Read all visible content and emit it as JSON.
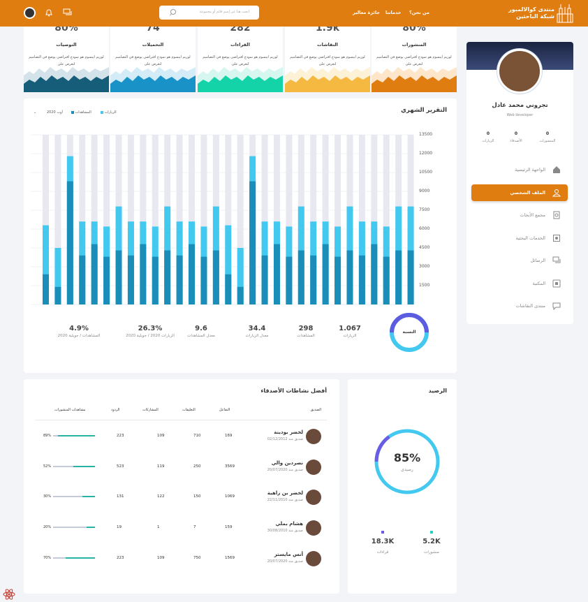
{
  "header": {
    "brand_line1": "منتدى كوالالمبور",
    "brand_line2": "شبكة الباحثين",
    "nav": [
      "من نحن؟",
      "خدماتنا",
      "جائزة معالير"
    ],
    "search_placeholder": "ابحث هنا عن إسم قائم أو مجموعة"
  },
  "stats": [
    {
      "number": "80%",
      "title": "المنشورات",
      "desc": "لوريم ايبسوم هو نموذج افتراضي يوضع في التصاميم لتعرض على",
      "color": "#e07d10",
      "light": "#fde6c9"
    },
    {
      "number": "1.9k",
      "title": "النقاشات",
      "desc": "لوريم ايبسوم هو نموذج افتراضي يوضع في التصاميم لتعرض على",
      "color": "#f5b840",
      "light": "#fdf1d6"
    },
    {
      "number": "282",
      "title": "القراءات",
      "desc": "لوريم ايبسوم هو نموذج افتراضي يوضع في التصاميم لتعرض على",
      "color": "#14d3a8",
      "light": "#d6f7ef"
    },
    {
      "number": "74",
      "title": "التحميلات",
      "desc": "لوريم ايبسوم هو نموذج افتراضي يوضع في التصاميم لتعرض على",
      "color": "#1992c8",
      "light": "#d3ecf7"
    },
    {
      "number": "80%",
      "title": "التوصيات",
      "desc": "لوريم ايبسوم هو نموذج افتراضي يوضع في التصاميم لتعرض على",
      "color": "#155d78",
      "light": "#d4e3ea"
    }
  ],
  "profile": {
    "name": "تجروني محمد عادل",
    "role": "Web developer",
    "stats": [
      {
        "value": "0",
        "label": "المنشورات"
      },
      {
        "value": "0",
        "label": "الأصدقاء"
      },
      {
        "value": "0",
        "label": "الزيارات"
      }
    ]
  },
  "menu": [
    {
      "label": "الواجهة الرئيسية",
      "icon": "home-icon",
      "active": false
    },
    {
      "label": "الملف الشخصي",
      "icon": "user-icon",
      "active": true
    },
    {
      "label": "مجمع الأبحاث",
      "icon": "document-icon",
      "active": false
    },
    {
      "label": "الخدمات البحثية",
      "icon": "gear-icon",
      "active": false
    },
    {
      "label": "الرسائل",
      "icon": "chat-icon",
      "active": false
    },
    {
      "label": "المكتبة",
      "icon": "book-icon",
      "active": false
    },
    {
      "label": "منتدى النقاشات",
      "icon": "forum-icon",
      "active": false
    }
  ],
  "monthly": {
    "title": "التقرير الشهري",
    "legend_visits": "الزيارات",
    "legend_views": "المشاهدات",
    "period": "أوت 2020",
    "donut_label": "النسبة",
    "kpis": [
      {
        "value": "1.067",
        "label": "الزيارات"
      },
      {
        "value": "298",
        "label": "المشاهدات"
      },
      {
        "value": "34.4",
        "label": "معدل الزيارات"
      },
      {
        "value": "9.6",
        "label": "معدل المشاهدات"
      },
      {
        "value": "26.3%",
        "label": "الزيارات 2020 / جويلية 2020"
      },
      {
        "value": "4.9%",
        "label": "المشاهدات / جويلية 2020"
      }
    ]
  },
  "chart_data": {
    "type": "bar",
    "series": [
      {
        "name": "الزيارات",
        "values": [
          6300,
          4500,
          11800,
          6600,
          6600,
          6200,
          7800,
          6600,
          6600,
          6200,
          7800,
          6600,
          6600,
          6200,
          7800,
          6300,
          4500,
          11800,
          6600,
          6600,
          6200,
          7800,
          6600,
          6600,
          6200,
          7800,
          6600,
          6600,
          6200,
          7800,
          7800
        ]
      },
      {
        "name": "المشاهدات",
        "values": [
          2400,
          1400,
          9800,
          3900,
          4800,
          3800,
          4300,
          3900,
          4800,
          3800,
          4300,
          3900,
          4800,
          3800,
          4300,
          2400,
          1400,
          9800,
          3900,
          4800,
          3800,
          4300,
          3900,
          4800,
          3800,
          4300,
          3900,
          4800,
          3800,
          4300,
          4300
        ]
      }
    ],
    "ylim": [
      0,
      13500
    ],
    "yticks": [
      "13500",
      "12000",
      "10500",
      "9000",
      "7500",
      "6000",
      "4500",
      "3000",
      "1500"
    ]
  },
  "friends": {
    "title": "أفضل نشاطات الأصدقاء",
    "headers": [
      "الصديق",
      "التفاعل",
      "التعليقات",
      "المشاركات",
      "الردود",
      "مشاهدات المنشورات"
    ],
    "rows": [
      {
        "name": "لخضر بودينة",
        "since": "صديق منذ 02/12/2012",
        "interaction": "169",
        "comments": "710",
        "shares": "109",
        "replies": "223",
        "pct": "89%",
        "fill": 0.89
      },
      {
        "name": "نصردين والي",
        "since": "صديق منذ 20/07/2020",
        "interaction": "3569",
        "comments": "250",
        "shares": "119",
        "replies": "523",
        "pct": "52%",
        "fill": 0.52
      },
      {
        "name": "لخضر بن زاهية",
        "since": "صديق منذ 22/11/2010",
        "interaction": "1069",
        "comments": "150",
        "shares": "122",
        "replies": "131",
        "pct": "30%",
        "fill": 0.3
      },
      {
        "name": "هشام بملي",
        "since": "صديق منذ 30/08/2010",
        "interaction": "159",
        "comments": "7",
        "shares": "1",
        "replies": "19",
        "pct": "20%",
        "fill": 0.2
      },
      {
        "name": "أنس مايستر",
        "since": "صديق منذ 20/07/2020",
        "interaction": "1569",
        "comments": "750",
        "shares": "109",
        "replies": "223",
        "pct": "70%",
        "fill": 0.7
      }
    ]
  },
  "balance": {
    "title": "الرصيد",
    "percent": "85%",
    "fill": 0.85,
    "caption": "رصيدي",
    "items": [
      {
        "value": "5.2K",
        "label": "منشورات",
        "color": "#20d3c2"
      },
      {
        "value": "18.3K",
        "label": "قراءات",
        "color": "#6a5ce6"
      }
    ]
  }
}
